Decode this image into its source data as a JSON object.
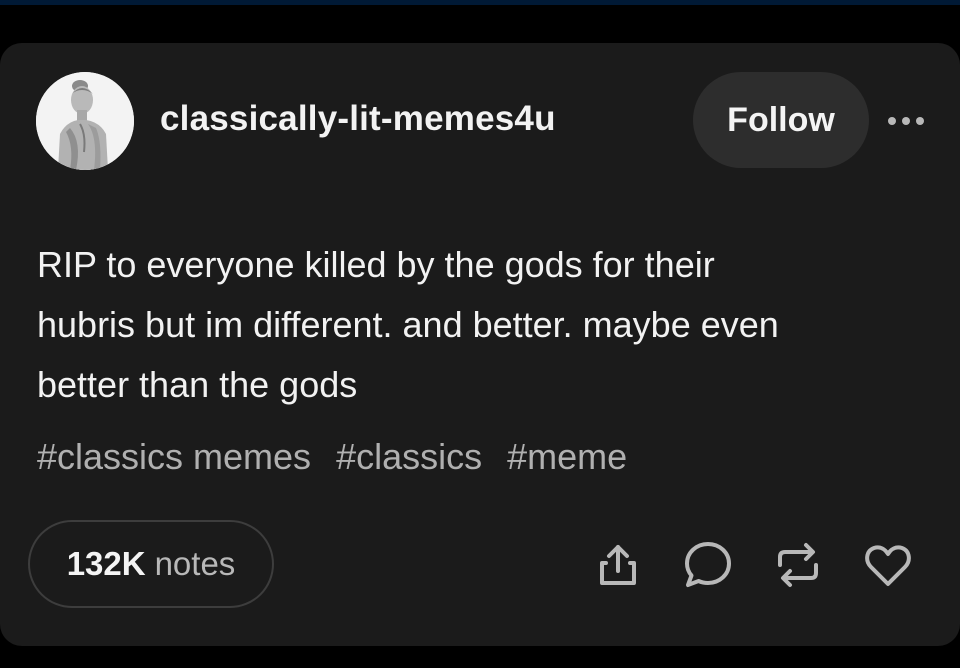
{
  "post": {
    "username": "classically-lit-memes4u",
    "follow_label": "Follow",
    "body_lines": [
      "RIP to everyone killed by the gods for their",
      "hubris but im different. and better. maybe even",
      "better than the gods"
    ],
    "tags": [
      "#classics memes",
      "#classics",
      "#meme"
    ],
    "notes": {
      "count": "132K",
      "label": "notes"
    }
  },
  "icons": {
    "avatar": "statue-bust-avatar",
    "more": "more-options-icon",
    "share": "share-icon",
    "reply": "reply-icon",
    "reblog": "reblog-icon",
    "like": "heart-icon"
  },
  "colors": {
    "background": "#000000",
    "card": "#1b1b1b",
    "text": "#f2f2f2",
    "tag_text": "#b0b0b0",
    "follow_bg": "#2d2d2d",
    "top_bar": "#001935"
  }
}
